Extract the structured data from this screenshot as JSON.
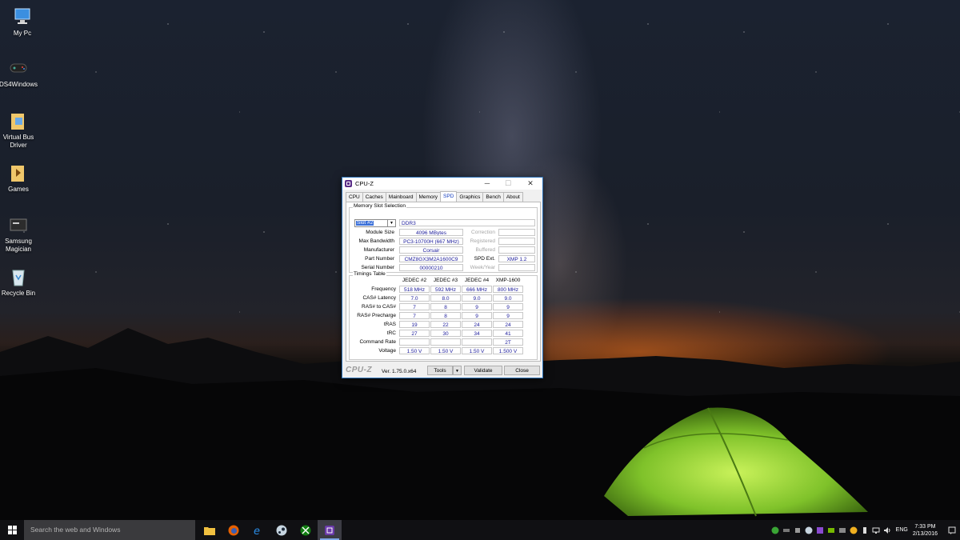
{
  "desktop": {
    "icons": [
      {
        "label": "My Pc",
        "icon": "computer-icon"
      },
      {
        "label": "DS4Windows",
        "icon": "gamepad-icon"
      },
      {
        "label": "Virtual Bus Driver",
        "icon": "folder-icon"
      },
      {
        "label": "Games",
        "icon": "folder-icon"
      },
      {
        "label": "Samsung Magician",
        "icon": "ssd-icon"
      },
      {
        "label": "Recycle Bin",
        "icon": "recycle-bin-icon"
      }
    ]
  },
  "window": {
    "title": "CPU-Z",
    "controls": {
      "minimize": "─",
      "maximize": "☐",
      "close": "✕"
    },
    "tabs": [
      "CPU",
      "Caches",
      "Mainboard",
      "Memory",
      "SPD",
      "Graphics",
      "Bench",
      "About"
    ],
    "active_tab": "SPD",
    "slot_group": {
      "title": "Memory Slot Selection",
      "slot_selected": "Slot #2",
      "memory_type": "DDR3",
      "module_size_label": "Module Size",
      "module_size": "4096 MBytes",
      "max_bandwidth_label": "Max Bandwidth",
      "max_bandwidth": "PC3-10700H (667 MHz)",
      "manufacturer_label": "Manufacturer",
      "manufacturer": "Corsair",
      "part_number_label": "Part Number",
      "part_number": "CMZ8GX3M2A1600C9",
      "serial_number_label": "Serial Number",
      "serial_number": "00000210",
      "correction_label": "Correction",
      "correction": "",
      "registered_label": "Registered",
      "registered": "",
      "buffered_label": "Buffered",
      "buffered": "",
      "spd_ext_label": "SPD Ext.",
      "spd_ext": "XMP 1.2",
      "week_year_label": "Week/Year",
      "week_year": ""
    },
    "timings": {
      "title": "Timings Table",
      "columns": [
        "JEDEC #2",
        "JEDEC #3",
        "JEDEC #4",
        "XMP-1600"
      ],
      "rows": [
        {
          "label": "Frequency",
          "values": [
            "518 MHz",
            "592 MHz",
            "666 MHz",
            "800 MHz"
          ]
        },
        {
          "label": "CAS# Latency",
          "values": [
            "7.0",
            "8.0",
            "9.0",
            "9.0"
          ]
        },
        {
          "label": "RAS# to CAS#",
          "values": [
            "7",
            "8",
            "9",
            "9"
          ]
        },
        {
          "label": "RAS# Precharge",
          "values": [
            "7",
            "8",
            "9",
            "9"
          ]
        },
        {
          "label": "tRAS",
          "values": [
            "19",
            "22",
            "24",
            "24"
          ]
        },
        {
          "label": "tRC",
          "values": [
            "27",
            "30",
            "34",
            "41"
          ]
        },
        {
          "label": "Command Rate",
          "values": [
            "",
            "",
            "",
            "2T"
          ]
        },
        {
          "label": "Voltage",
          "values": [
            "1.50 V",
            "1.50 V",
            "1.50 V",
            "1.500 V"
          ]
        }
      ]
    },
    "footer": {
      "logo": "CPU-Z",
      "version": "Ver. 1.75.0.x64",
      "tools_label": "Tools",
      "validate_label": "Validate",
      "close_label": "Close"
    }
  },
  "taskbar": {
    "search_placeholder": "Search the web and Windows",
    "apps": [
      "file-explorer-icon",
      "firefox-icon",
      "internet-explorer-icon",
      "steam-icon",
      "xbox-icon",
      "cpu-z-icon"
    ],
    "tray_icons": [
      "utorrent-icon",
      "tray-app-icon",
      "tray-app-icon",
      "steam-icon",
      "tray-app-icon",
      "nvidia-icon",
      "network-adapter-icon",
      "tray-app-icon",
      "usb-icon",
      "network-icon",
      "volume-icon"
    ],
    "language": "ENG",
    "time": "7:33 PM",
    "date": "2/13/2016"
  }
}
